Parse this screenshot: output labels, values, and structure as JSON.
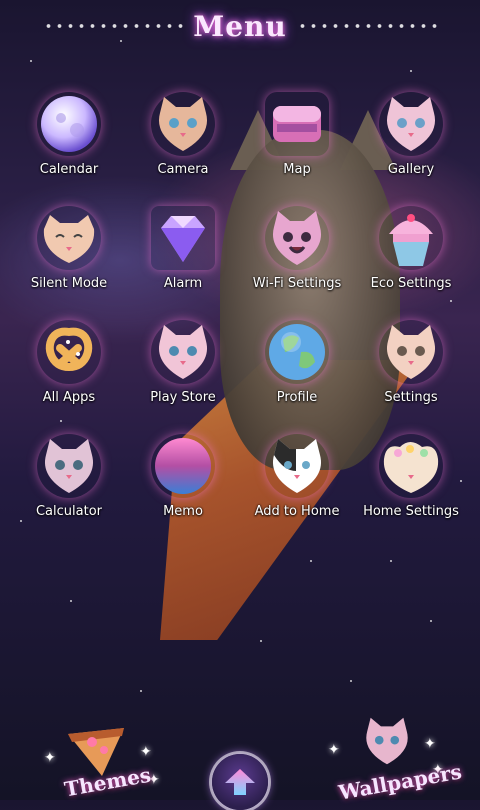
{
  "header": {
    "title": "Menu"
  },
  "apps": [
    {
      "label": "Calendar",
      "icon": "moon-icon"
    },
    {
      "label": "Camera",
      "icon": "cat-icon"
    },
    {
      "label": "Map",
      "icon": "gem-box-icon"
    },
    {
      "label": "Gallery",
      "icon": "cat-icon"
    },
    {
      "label": "Silent Mode",
      "icon": "cat-icon"
    },
    {
      "label": "Alarm",
      "icon": "diamond-icon"
    },
    {
      "label": "Wi-Fi Settings",
      "icon": "cat-icon"
    },
    {
      "label": "Eco Settings",
      "icon": "cupcake-icon"
    },
    {
      "label": "All Apps",
      "icon": "pretzel-icon"
    },
    {
      "label": "Play Store",
      "icon": "cat-icon"
    },
    {
      "label": "Profile",
      "icon": "earth-icon"
    },
    {
      "label": "Settings",
      "icon": "cat-icon"
    },
    {
      "label": "Calculator",
      "icon": "cat-icon"
    },
    {
      "label": "Memo",
      "icon": "planet-icon"
    },
    {
      "label": "Add to Home",
      "icon": "cat-icon"
    },
    {
      "label": "Home Settings",
      "icon": "cat-icon"
    }
  ],
  "dock": {
    "themes_label": "Themes",
    "wallpapers_label": "Wallpapers"
  }
}
